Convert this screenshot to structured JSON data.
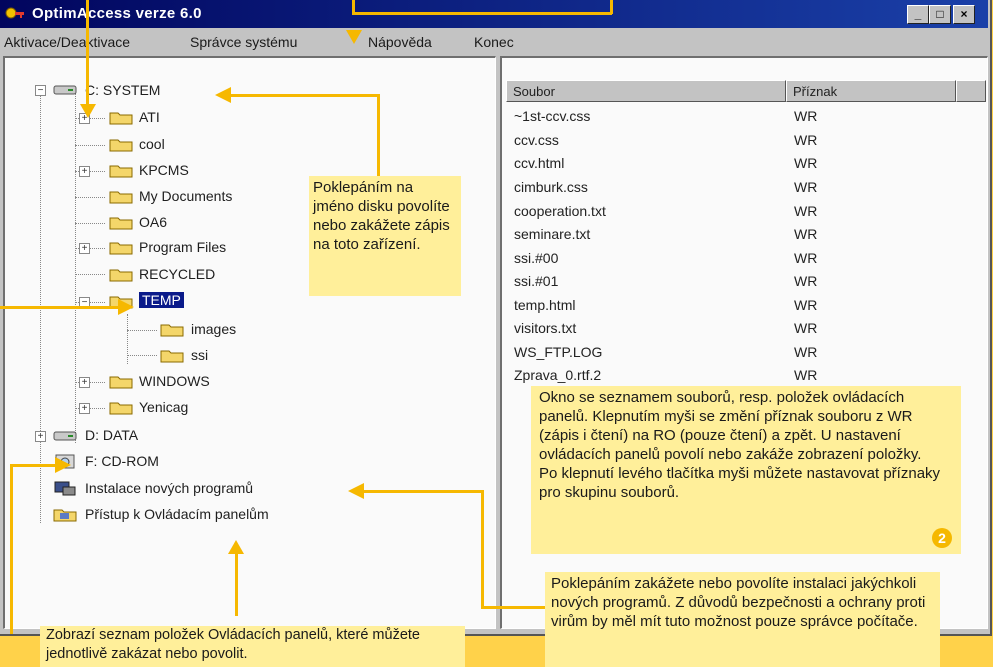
{
  "window": {
    "title": "OptimAccess verze 6.0",
    "min_label": "_",
    "max_label": "□",
    "close_label": "×"
  },
  "menu": [
    "Aktivace/Deaktivace",
    "Správce systému",
    "Nápověda",
    "Konec"
  ],
  "tree": {
    "drive_c": "C: SYSTEM",
    "folders": [
      "ATI",
      "cool",
      "KPCMS",
      "My Documents",
      "OA6",
      "Program Files",
      "RECYCLED",
      "TEMP"
    ],
    "temp_children": [
      "images",
      "ssi"
    ],
    "more_folders": [
      "WINDOWS",
      "Yenicag"
    ],
    "drive_d": "D: DATA",
    "drive_f": "F: CD-ROM",
    "install": "Instalace nových programů",
    "control_panels": "Přístup k Ovládacím panelům"
  },
  "files": {
    "columns": [
      "Soubor",
      "Příznak"
    ],
    "rows": [
      [
        "~1st-ccv.css",
        "WR"
      ],
      [
        "ccv.css",
        "WR"
      ],
      [
        "ccv.html",
        "WR"
      ],
      [
        "cimburk.css",
        "WR"
      ],
      [
        "cooperation.txt",
        "WR"
      ],
      [
        "seminare.txt",
        "WR"
      ],
      [
        "ssi.#00",
        "WR"
      ],
      [
        "ssi.#01",
        "WR"
      ],
      [
        "temp.html",
        "WR"
      ],
      [
        "visitors.txt",
        "WR"
      ],
      [
        "WS_FTP.LOG",
        "WR"
      ],
      [
        "Zprava_0.rtf.2",
        "WR"
      ]
    ]
  },
  "callouts": {
    "disk": "Poklepáním na jméno disku povolíte nebo zakážete zápis na toto zařízení.",
    "files": "Okno se seznamem souborů, resp. položek ovládacích panelů. Klepnutím myši se změní příznak souboru z WR (zápis i čtení) na RO (pouze čtení) a zpět. U nastavení ovládacích panelů povolí nebo zakáže zobrazení položky.\nPo klepnutí levého tlačítka myši můžete nastavovat příznaky pro skupinu souborů.",
    "install": "Poklepáním zakážete nebo povolíte instalaci jakýchkoli nových programů. Z důvodů bezpečnosti a ochrany proti virům by měl mít tuto možnost pouze správce počítače.",
    "panels": "Zobrazí seznam položek Ovládacích panelů, které můžete jednotlivě zakázat nebo povolit."
  },
  "badge": "2",
  "colors": {
    "accent": "#f6b800",
    "callout_bg": "#ffef9a",
    "titlebar": "#01055e",
    "selection": "#0a1a8a"
  }
}
